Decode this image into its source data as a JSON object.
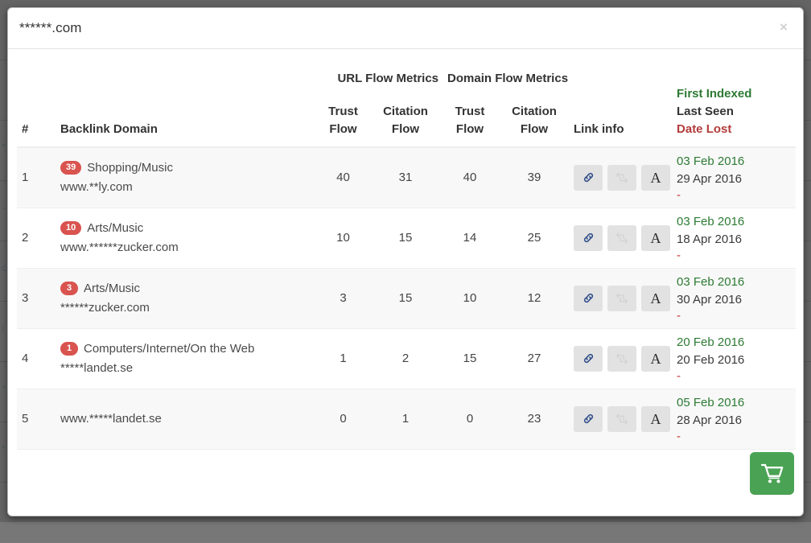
{
  "modal": {
    "title": "******.com",
    "close_label": "×"
  },
  "table": {
    "group_headers": {
      "url_flow_metrics": "URL Flow Metrics",
      "domain_flow_metrics": "Domain Flow Metrics"
    },
    "columns": {
      "num": "#",
      "backlink_domain": "Backlink Domain",
      "url_trust_flow": "Trust Flow",
      "url_trust_flow_l1": "Trust",
      "url_trust_flow_l2": "Flow",
      "url_citation_flow_l1": "Citation",
      "url_citation_flow_l2": "Flow",
      "dom_trust_flow_l1": "Trust",
      "dom_trust_flow_l2": "Flow",
      "dom_citation_flow_l1": "Citation",
      "dom_citation_flow_l2": "Flow",
      "link_info": "Link info",
      "first_indexed": "First Indexed",
      "last_seen": "Last Seen",
      "date_lost": "Date Lost"
    },
    "rows": [
      {
        "num": "1",
        "badge": "39",
        "category": "Shopping/Music",
        "url": "www.**ly.com",
        "url_trust_flow": "40",
        "url_citation_flow": "31",
        "dom_trust_flow": "40",
        "dom_citation_flow": "39",
        "first_indexed": "03 Feb 2016",
        "last_seen": "29 Apr 2016",
        "date_lost": "-"
      },
      {
        "num": "2",
        "badge": "10",
        "category": "Arts/Music",
        "url": "www.******zucker.com",
        "url_trust_flow": "10",
        "url_citation_flow": "15",
        "dom_trust_flow": "14",
        "dom_citation_flow": "25",
        "first_indexed": "03 Feb 2016",
        "last_seen": "18 Apr 2016",
        "date_lost": "-"
      },
      {
        "num": "3",
        "badge": "3",
        "category": "Arts/Music",
        "url": "******zucker.com",
        "url_trust_flow": "3",
        "url_citation_flow": "15",
        "dom_trust_flow": "10",
        "dom_citation_flow": "12",
        "first_indexed": "03 Feb 2016",
        "last_seen": "30 Apr 2016",
        "date_lost": "-"
      },
      {
        "num": "4",
        "badge": "1",
        "category": "Computers/Internet/On the Web",
        "url": "*****landet.se",
        "url_trust_flow": "1",
        "url_citation_flow": "2",
        "dom_trust_flow": "15",
        "dom_citation_flow": "27",
        "first_indexed": "20 Feb 2016",
        "last_seen": "20 Feb 2016",
        "date_lost": "-"
      },
      {
        "num": "5",
        "badge": "",
        "category": "",
        "url": "www.*****landet.se",
        "url_trust_flow": "0",
        "url_citation_flow": "1",
        "dom_trust_flow": "0",
        "dom_citation_flow": "23",
        "first_indexed": "05 Feb 2016",
        "last_seen": "28 Apr 2016",
        "date_lost": "-"
      }
    ],
    "link_icons": {
      "link": "chain-link-icon",
      "share": "retweet-icon",
      "anchor": "A"
    }
  },
  "footer": {
    "cart_label": "shopping-cart-icon"
  },
  "colors": {
    "badge": "#d9534f",
    "first_indexed": "#2d7a34",
    "date_lost": "#c9302c",
    "cart": "#4aa354",
    "link_icon": "#33508a"
  }
}
